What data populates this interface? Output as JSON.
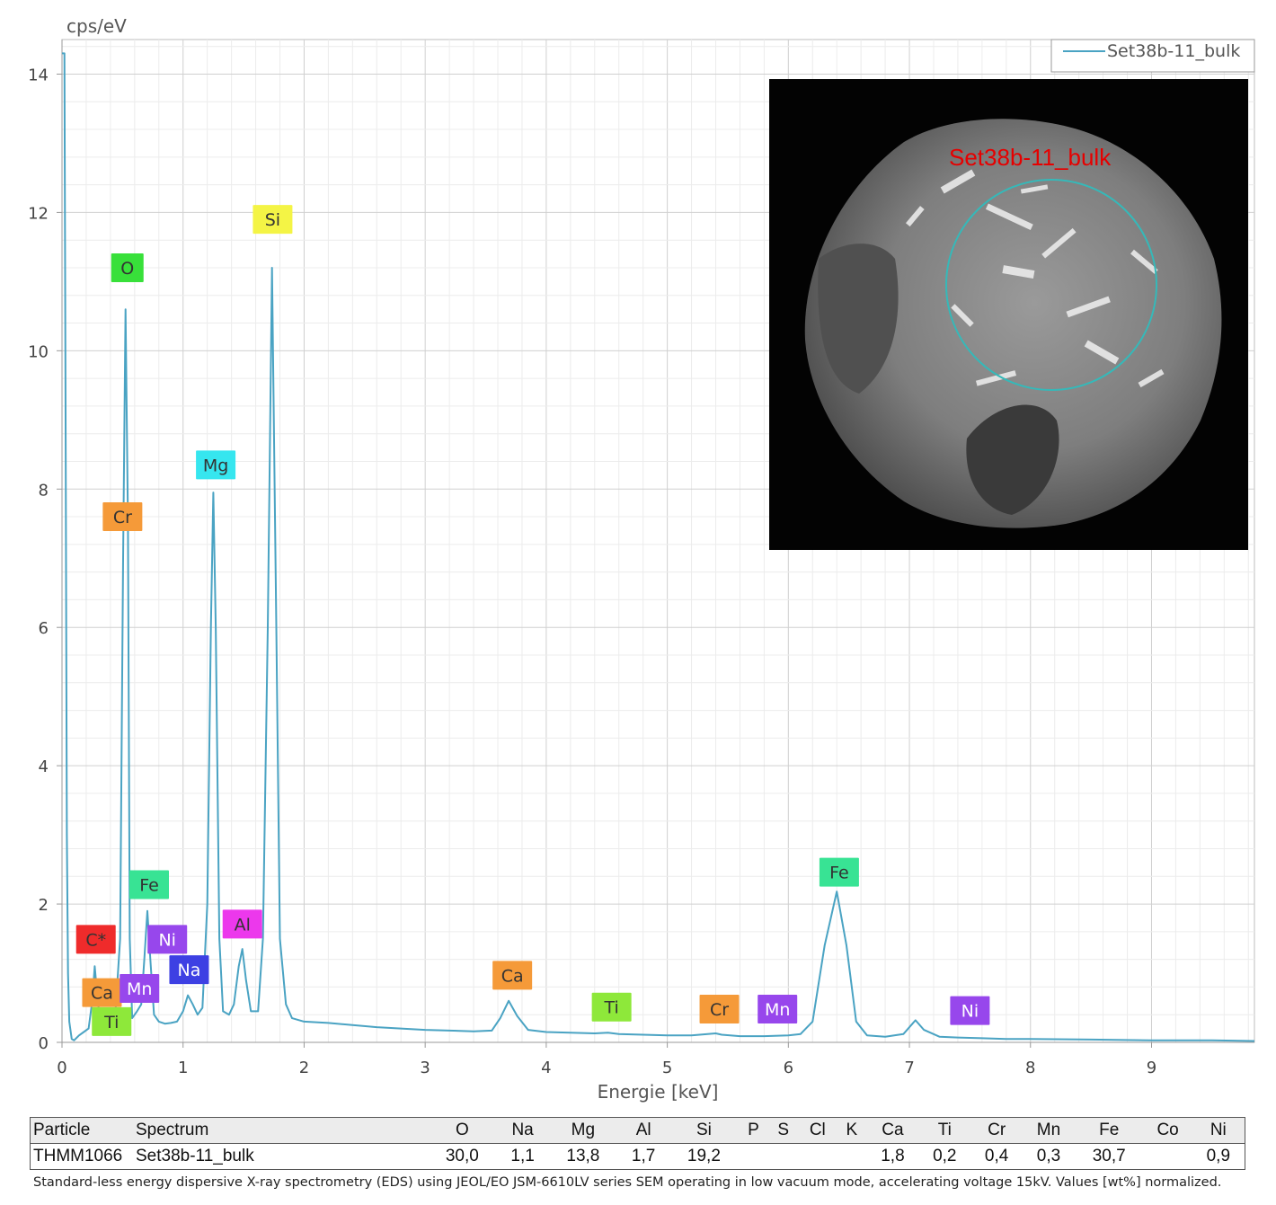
{
  "chart_data": {
    "type": "line",
    "ylabel": "cps/eV",
    "xlabel": "Energie [keV]",
    "xlim": [
      0,
      9.85
    ],
    "ylim": [
      0,
      14.5
    ],
    "x_ticks": [
      "0",
      "1",
      "2",
      "3",
      "4",
      "5",
      "6",
      "7",
      "8",
      "9"
    ],
    "y_ticks": [
      "0",
      "2",
      "4",
      "6",
      "8",
      "10",
      "12",
      "14"
    ],
    "grid": true,
    "legend_position": "top-right",
    "series": [
      {
        "name": "Set38b-11_bulk",
        "color": "#4aa3c3",
        "points": [
          [
            0.0,
            14.3
          ],
          [
            0.02,
            14.3
          ],
          [
            0.03,
            9.0
          ],
          [
            0.04,
            3.0
          ],
          [
            0.05,
            1.0
          ],
          [
            0.06,
            0.3
          ],
          [
            0.08,
            0.05
          ],
          [
            0.1,
            0.03
          ],
          [
            0.14,
            0.1
          ],
          [
            0.18,
            0.15
          ],
          [
            0.22,
            0.2
          ],
          [
            0.25,
            0.6
          ],
          [
            0.27,
            1.1
          ],
          [
            0.29,
            0.7
          ],
          [
            0.32,
            0.2
          ],
          [
            0.36,
            0.18
          ],
          [
            0.4,
            0.25
          ],
          [
            0.44,
            0.4
          ],
          [
            0.48,
            1.5
          ],
          [
            0.505,
            7.0
          ],
          [
            0.525,
            10.6
          ],
          [
            0.545,
            7.5
          ],
          [
            0.56,
            1.5
          ],
          [
            0.58,
            0.35
          ],
          [
            0.62,
            0.45
          ],
          [
            0.655,
            0.55
          ],
          [
            0.68,
            1.2
          ],
          [
            0.705,
            1.9
          ],
          [
            0.73,
            1.2
          ],
          [
            0.76,
            0.4
          ],
          [
            0.8,
            0.3
          ],
          [
            0.85,
            0.27
          ],
          [
            0.9,
            0.28
          ],
          [
            0.95,
            0.3
          ],
          [
            1.0,
            0.45
          ],
          [
            1.04,
            0.68
          ],
          [
            1.08,
            0.55
          ],
          [
            1.12,
            0.4
          ],
          [
            1.16,
            0.5
          ],
          [
            1.2,
            2.0
          ],
          [
            1.23,
            6.0
          ],
          [
            1.25,
            7.95
          ],
          [
            1.27,
            6.0
          ],
          [
            1.3,
            1.5
          ],
          [
            1.33,
            0.45
          ],
          [
            1.38,
            0.4
          ],
          [
            1.42,
            0.55
          ],
          [
            1.46,
            1.1
          ],
          [
            1.49,
            1.35
          ],
          [
            1.52,
            0.9
          ],
          [
            1.56,
            0.45
          ],
          [
            1.62,
            0.45
          ],
          [
            1.66,
            1.5
          ],
          [
            1.7,
            6.0
          ],
          [
            1.735,
            11.2
          ],
          [
            1.77,
            6.0
          ],
          [
            1.8,
            1.5
          ],
          [
            1.85,
            0.55
          ],
          [
            1.9,
            0.35
          ],
          [
            2.0,
            0.3
          ],
          [
            2.2,
            0.28
          ],
          [
            2.4,
            0.25
          ],
          [
            2.6,
            0.22
          ],
          [
            2.8,
            0.2
          ],
          [
            3.0,
            0.18
          ],
          [
            3.2,
            0.17
          ],
          [
            3.4,
            0.16
          ],
          [
            3.55,
            0.17
          ],
          [
            3.62,
            0.35
          ],
          [
            3.69,
            0.6
          ],
          [
            3.76,
            0.38
          ],
          [
            3.85,
            0.18
          ],
          [
            4.0,
            0.15
          ],
          [
            4.2,
            0.14
          ],
          [
            4.4,
            0.13
          ],
          [
            4.51,
            0.14
          ],
          [
            4.6,
            0.12
          ],
          [
            4.8,
            0.11
          ],
          [
            5.0,
            0.1
          ],
          [
            5.2,
            0.1
          ],
          [
            5.4,
            0.13
          ],
          [
            5.45,
            0.11
          ],
          [
            5.6,
            0.09
          ],
          [
            5.8,
            0.09
          ],
          [
            6.0,
            0.1
          ],
          [
            6.1,
            0.12
          ],
          [
            6.2,
            0.3
          ],
          [
            6.3,
            1.4
          ],
          [
            6.4,
            2.18
          ],
          [
            6.48,
            1.4
          ],
          [
            6.56,
            0.3
          ],
          [
            6.65,
            0.1
          ],
          [
            6.8,
            0.08
          ],
          [
            6.95,
            0.12
          ],
          [
            7.05,
            0.32
          ],
          [
            7.12,
            0.18
          ],
          [
            7.25,
            0.08
          ],
          [
            7.4,
            0.07
          ],
          [
            7.6,
            0.06
          ],
          [
            7.8,
            0.05
          ],
          [
            8.0,
            0.05
          ],
          [
            8.5,
            0.04
          ],
          [
            9.0,
            0.03
          ],
          [
            9.5,
            0.03
          ],
          [
            9.85,
            0.02
          ]
        ]
      }
    ],
    "element_labels": [
      {
        "text": "O",
        "x": 0.54,
        "y": 11.2,
        "color": "#38e03a",
        "text_color": "#333333"
      },
      {
        "text": "Si",
        "x": 1.74,
        "y": 11.9,
        "color": "#f4f445",
        "text_color": "#333333"
      },
      {
        "text": "Mg",
        "x": 1.27,
        "y": 8.35,
        "color": "#36e6ef",
        "text_color": "#333333"
      },
      {
        "text": "Cr",
        "x": 0.5,
        "y": 7.6,
        "color": "#f59a39",
        "text_color": "#333333"
      },
      {
        "text": "Fe",
        "x": 0.72,
        "y": 2.28,
        "color": "#38e394",
        "text_color": "#333333"
      },
      {
        "text": "C*",
        "x": 0.28,
        "y": 1.49,
        "color": "#ef2b2b",
        "text_color": "#333333"
      },
      {
        "text": "Ni",
        "x": 0.87,
        "y": 1.49,
        "color": "#9747ec",
        "text_color": "#ffffff"
      },
      {
        "text": "Al",
        "x": 1.49,
        "y": 1.71,
        "color": "#ec38ec",
        "text_color": "#333333"
      },
      {
        "text": "Na",
        "x": 1.05,
        "y": 1.05,
        "color": "#3d40e3",
        "text_color": "#ffffff"
      },
      {
        "text": "Ca",
        "x": 0.33,
        "y": 0.72,
        "color": "#f59a39",
        "text_color": "#333333"
      },
      {
        "text": "Mn",
        "x": 0.64,
        "y": 0.78,
        "color": "#9747ec",
        "text_color": "#ffffff"
      },
      {
        "text": "Ti",
        "x": 0.41,
        "y": 0.3,
        "color": "#8ee83a",
        "text_color": "#333333"
      },
      {
        "text": "Ca",
        "x": 3.72,
        "y": 0.97,
        "color": "#f59a39",
        "text_color": "#333333"
      },
      {
        "text": "Ti",
        "x": 4.54,
        "y": 0.51,
        "color": "#8ee83a",
        "text_color": "#333333"
      },
      {
        "text": "Cr",
        "x": 5.43,
        "y": 0.48,
        "color": "#f59a39",
        "text_color": "#333333"
      },
      {
        "text": "Mn",
        "x": 5.91,
        "y": 0.48,
        "color": "#9747ec",
        "text_color": "#ffffff"
      },
      {
        "text": "Fe",
        "x": 6.42,
        "y": 2.46,
        "color": "#38e394",
        "text_color": "#333333"
      },
      {
        "text": "Ni",
        "x": 7.5,
        "y": 0.46,
        "color": "#9747ec",
        "text_color": "#ffffff"
      }
    ]
  },
  "sem_image": {
    "label": "Set38b-11_bulk",
    "label_color": "#e60000",
    "circle_color": "#35b9b9"
  },
  "table": {
    "headers": [
      "Particle",
      "Spectrum",
      "O",
      "Na",
      "Mg",
      "Al",
      "Si",
      "P",
      "S",
      "Cl",
      "K",
      "Ca",
      "Ti",
      "Cr",
      "Mn",
      "Fe",
      "Co",
      "Ni"
    ],
    "row": [
      "THMM1066",
      "Set38b-11_bulk",
      "30,0",
      "1,1",
      "13,8",
      "1,7",
      "19,2",
      "",
      "",
      "",
      "",
      "1,8",
      "0,2",
      "0,4",
      "0,3",
      "30,7",
      "",
      "0,9"
    ]
  },
  "footnote": "Standard-less energy dispersive X-ray spectrometry (EDS) using JEOL/EO JSM-6610LV series SEM operating in low vacuum mode, accelerating voltage 15kV. Values [wt%] normalized."
}
